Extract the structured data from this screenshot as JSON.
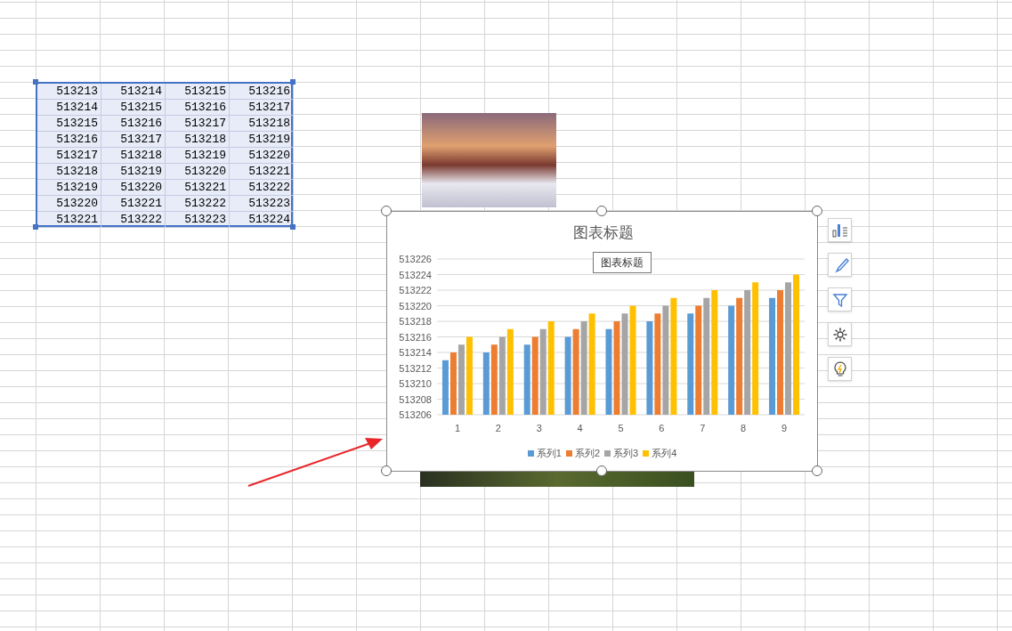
{
  "table": {
    "selected": true,
    "rows": [
      [
        "513213",
        "513214",
        "513215",
        "513216"
      ],
      [
        "513214",
        "513215",
        "513216",
        "513217"
      ],
      [
        "513215",
        "513216",
        "513217",
        "513218"
      ],
      [
        "513216",
        "513217",
        "513218",
        "513219"
      ],
      [
        "513217",
        "513218",
        "513219",
        "513220"
      ],
      [
        "513218",
        "513219",
        "513220",
        "513221"
      ],
      [
        "513219",
        "513220",
        "513221",
        "513222"
      ],
      [
        "513220",
        "513221",
        "513222",
        "513223"
      ],
      [
        "513221",
        "513222",
        "513223",
        "513224"
      ]
    ]
  },
  "chart": {
    "selected": true,
    "tooltip": "图表标题",
    "chart_data": {
      "type": "bar",
      "title": "图表标题",
      "grid": true,
      "legend": true,
      "categories": [
        "1",
        "2",
        "3",
        "4",
        "5",
        "6",
        "7",
        "8",
        "9"
      ],
      "series": [
        {
          "name": "系列1",
          "color": "#5b9bd5",
          "values": [
            513213,
            513214,
            513215,
            513216,
            513217,
            513218,
            513219,
            513220,
            513221
          ]
        },
        {
          "name": "系列2",
          "color": "#ed7d31",
          "values": [
            513214,
            513215,
            513216,
            513217,
            513218,
            513219,
            513220,
            513221,
            513222
          ]
        },
        {
          "name": "系列3",
          "color": "#a5a5a5",
          "values": [
            513215,
            513216,
            513217,
            513218,
            513219,
            513220,
            513221,
            513222,
            513223
          ]
        },
        {
          "name": "系列4",
          "color": "#ffc000",
          "values": [
            513216,
            513217,
            513218,
            513219,
            513220,
            513221,
            513222,
            513223,
            513224
          ]
        }
      ],
      "ylim": [
        513206,
        513226
      ],
      "yticks": [
        {
          "value": 513206,
          "label": "513206"
        },
        {
          "value": 513208,
          "label": "513208"
        },
        {
          "value": 513210,
          "label": "513210"
        },
        {
          "value": 513212,
          "label": "513212"
        },
        {
          "value": 513214,
          "label": "513214"
        },
        {
          "value": 513216,
          "label": "513216"
        },
        {
          "value": 513218,
          "label": "513218"
        },
        {
          "value": 513220,
          "label": "513220"
        },
        {
          "value": 513222,
          "label": "513222"
        },
        {
          "value": 513224,
          "label": "513224"
        },
        {
          "value": 513226,
          "label": "513226"
        }
      ]
    }
  }
}
